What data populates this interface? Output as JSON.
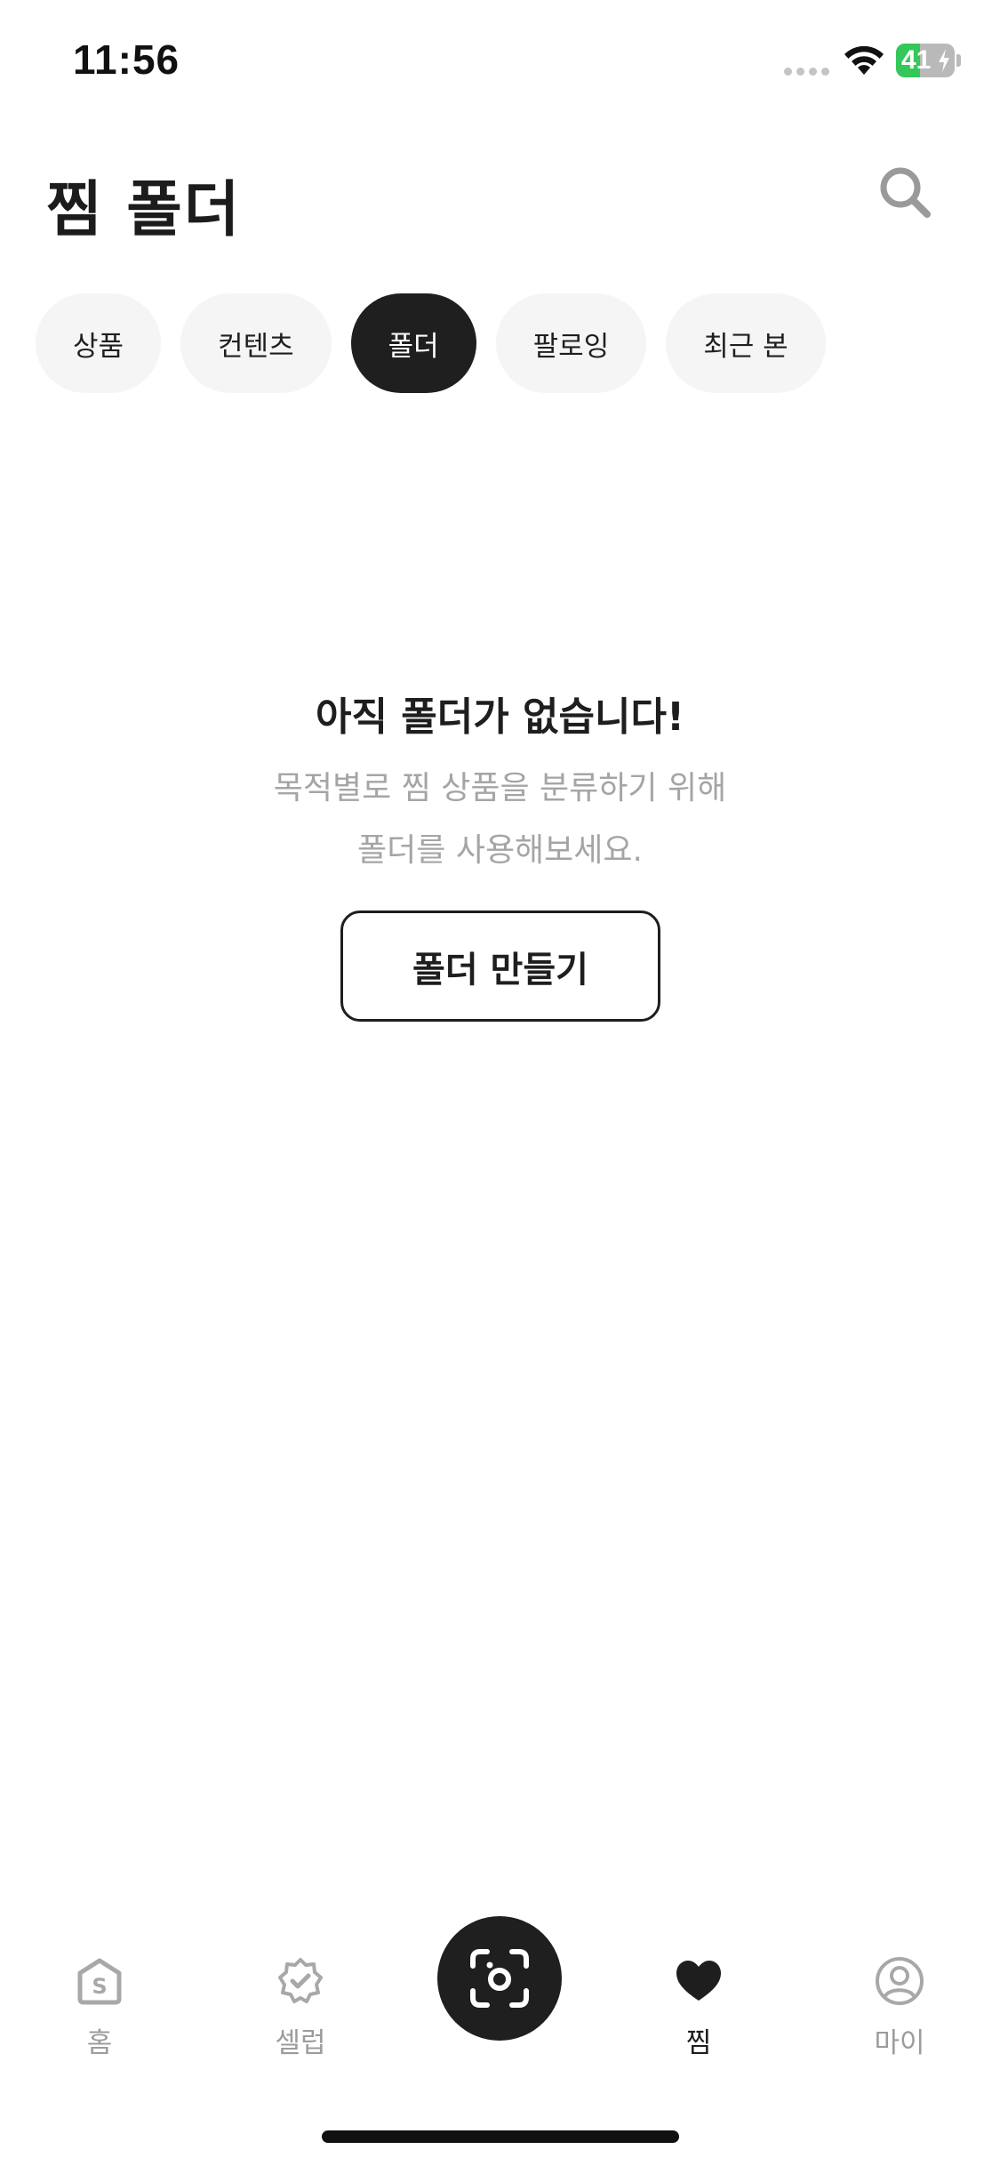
{
  "status_bar": {
    "time": "11:56",
    "battery_level": "41",
    "battery_fraction": 0.41,
    "battery_color": "#34c759",
    "icons": [
      "signal-icon",
      "wifi-icon",
      "battery-charging-icon"
    ]
  },
  "header": {
    "title": "찜 폴더",
    "search_icon": "search-icon"
  },
  "chips": [
    {
      "label": "상품",
      "active": false
    },
    {
      "label": "컨텐츠",
      "active": false
    },
    {
      "label": "폴더",
      "active": true
    },
    {
      "label": "팔로잉",
      "active": false
    },
    {
      "label": "최근 본",
      "active": false
    }
  ],
  "empty_state": {
    "title": "아직 폴더가 없습니다!",
    "description_line1": "목적별로 찜 상품을 분류하기 위해",
    "description_line2": "폴더를 사용해보세요.",
    "create_button": "폴더 만들기"
  },
  "tab_bar": {
    "tabs": [
      {
        "label": "홈",
        "icon": "home-icon",
        "active": false
      },
      {
        "label": "셀럽",
        "icon": "verified-badge-icon",
        "active": false
      },
      {
        "label": "",
        "icon": "camera-scan-icon",
        "active": false
      },
      {
        "label": "찜",
        "icon": "heart-icon",
        "active": true
      },
      {
        "label": "마이",
        "icon": "profile-icon",
        "active": false
      }
    ]
  },
  "colors": {
    "accent_dark": "#1f1f1f",
    "chip_bg": "#f5f5f5",
    "muted_text": "#a5a5a5",
    "inactive_icon": "#a8a8a8"
  }
}
